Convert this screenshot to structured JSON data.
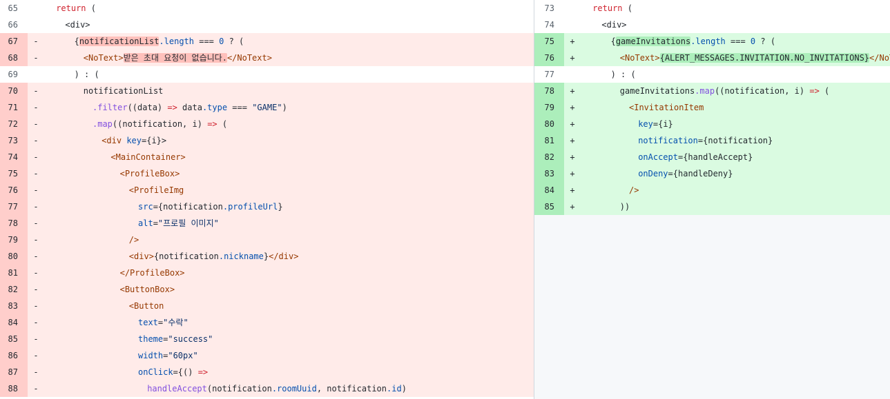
{
  "left_lines": [
    {
      "num": "65",
      "type": "ctx",
      "sign": "",
      "indent": 2,
      "tokens": [
        {
          "t": "return",
          "c": "kw"
        },
        {
          "t": " ("
        }
      ]
    },
    {
      "num": "66",
      "type": "ctx",
      "sign": "",
      "indent": 4,
      "tokens": [
        {
          "t": "<div>"
        }
      ]
    },
    {
      "num": "67",
      "type": "del",
      "sign": "-",
      "indent": 6,
      "tokens": [
        {
          "t": "{"
        },
        {
          "t": "notificationList",
          "c": "hl-del"
        },
        {
          "t": ".length",
          "c": "prop"
        },
        {
          "t": " === "
        },
        {
          "t": "0",
          "c": "num-lit"
        },
        {
          "t": " ? ("
        }
      ]
    },
    {
      "num": "68",
      "type": "del",
      "sign": "-",
      "indent": 8,
      "tokens": [
        {
          "t": "<NoText>",
          "c": "tag"
        },
        {
          "t": "받은 초대 요청이 없습니다.",
          "c": "hl-del"
        },
        {
          "t": "</NoText>",
          "c": "tag"
        }
      ]
    },
    {
      "num": "69",
      "type": "ctx",
      "sign": "",
      "indent": 6,
      "tokens": [
        {
          "t": ") : ("
        }
      ]
    },
    {
      "num": "70",
      "type": "del",
      "sign": "-",
      "indent": 8,
      "tokens": [
        {
          "t": "notificationList"
        }
      ]
    },
    {
      "num": "71",
      "type": "del",
      "sign": "-",
      "indent": 10,
      "tokens": [
        {
          "t": ".filter",
          "c": "fn"
        },
        {
          "t": "((data) "
        },
        {
          "t": "=>",
          "c": "kw"
        },
        {
          "t": " data"
        },
        {
          "t": ".type",
          "c": "prop"
        },
        {
          "t": " === "
        },
        {
          "t": "\"GAME\"",
          "c": "str"
        },
        {
          "t": ")"
        }
      ]
    },
    {
      "num": "72",
      "type": "del",
      "sign": "-",
      "indent": 10,
      "tokens": [
        {
          "t": ".map",
          "c": "fn"
        },
        {
          "t": "((notification, i) "
        },
        {
          "t": "=>",
          "c": "kw"
        },
        {
          "t": " ("
        }
      ]
    },
    {
      "num": "73",
      "type": "del",
      "sign": "-",
      "indent": 12,
      "tokens": [
        {
          "t": "<div",
          "c": "tag"
        },
        {
          "t": " key",
          "c": "attr"
        },
        {
          "t": "={i}>"
        }
      ]
    },
    {
      "num": "74",
      "type": "del",
      "sign": "-",
      "indent": 14,
      "tokens": [
        {
          "t": "<MainContainer>",
          "c": "tag"
        }
      ]
    },
    {
      "num": "75",
      "type": "del",
      "sign": "-",
      "indent": 16,
      "tokens": [
        {
          "t": "<ProfileBox>",
          "c": "tag"
        }
      ]
    },
    {
      "num": "76",
      "type": "del",
      "sign": "-",
      "indent": 18,
      "tokens": [
        {
          "t": "<ProfileImg",
          "c": "tag"
        }
      ]
    },
    {
      "num": "77",
      "type": "del",
      "sign": "-",
      "indent": 20,
      "tokens": [
        {
          "t": "src",
          "c": "attr"
        },
        {
          "t": "={notification"
        },
        {
          "t": ".profileUrl",
          "c": "prop"
        },
        {
          "t": "}"
        }
      ]
    },
    {
      "num": "78",
      "type": "del",
      "sign": "-",
      "indent": 20,
      "tokens": [
        {
          "t": "alt",
          "c": "attr"
        },
        {
          "t": "="
        },
        {
          "t": "\"프로필 이미지\"",
          "c": "str"
        }
      ]
    },
    {
      "num": "79",
      "type": "del",
      "sign": "-",
      "indent": 18,
      "tokens": [
        {
          "t": "/>",
          "c": "tag"
        }
      ]
    },
    {
      "num": "80",
      "type": "del",
      "sign": "-",
      "indent": 18,
      "tokens": [
        {
          "t": "<div>",
          "c": "tag"
        },
        {
          "t": "{notification"
        },
        {
          "t": ".nickname",
          "c": "prop"
        },
        {
          "t": "}"
        },
        {
          "t": "</div>",
          "c": "tag"
        }
      ]
    },
    {
      "num": "81",
      "type": "del",
      "sign": "-",
      "indent": 16,
      "tokens": [
        {
          "t": "</ProfileBox>",
          "c": "tag"
        }
      ]
    },
    {
      "num": "82",
      "type": "del",
      "sign": "-",
      "indent": 16,
      "tokens": [
        {
          "t": "<ButtonBox>",
          "c": "tag"
        }
      ]
    },
    {
      "num": "83",
      "type": "del",
      "sign": "-",
      "indent": 18,
      "tokens": [
        {
          "t": "<Button",
          "c": "tag"
        }
      ]
    },
    {
      "num": "84",
      "type": "del",
      "sign": "-",
      "indent": 20,
      "tokens": [
        {
          "t": "text",
          "c": "attr"
        },
        {
          "t": "="
        },
        {
          "t": "\"수락\"",
          "c": "str"
        }
      ]
    },
    {
      "num": "85",
      "type": "del",
      "sign": "-",
      "indent": 20,
      "tokens": [
        {
          "t": "theme",
          "c": "attr"
        },
        {
          "t": "="
        },
        {
          "t": "\"success\"",
          "c": "str"
        }
      ]
    },
    {
      "num": "86",
      "type": "del",
      "sign": "-",
      "indent": 20,
      "tokens": [
        {
          "t": "width",
          "c": "attr"
        },
        {
          "t": "="
        },
        {
          "t": "\"60px\"",
          "c": "str"
        }
      ]
    },
    {
      "num": "87",
      "type": "del",
      "sign": "-",
      "indent": 20,
      "tokens": [
        {
          "t": "onClick",
          "c": "attr"
        },
        {
          "t": "={() "
        },
        {
          "t": "=>",
          "c": "kw"
        }
      ]
    },
    {
      "num": "88",
      "type": "del",
      "sign": "-",
      "indent": 22,
      "tokens": [
        {
          "t": "handleAccept",
          "c": "fn"
        },
        {
          "t": "(notification"
        },
        {
          "t": ".roomUuid",
          "c": "prop"
        },
        {
          "t": ", notification"
        },
        {
          "t": ".id",
          "c": "prop"
        },
        {
          "t": ")"
        }
      ]
    }
  ],
  "right_lines": [
    {
      "num": "73",
      "type": "ctx",
      "sign": "",
      "indent": 2,
      "tokens": [
        {
          "t": "return",
          "c": "kw"
        },
        {
          "t": " ("
        }
      ]
    },
    {
      "num": "74",
      "type": "ctx",
      "sign": "",
      "indent": 4,
      "tokens": [
        {
          "t": "<div>"
        }
      ]
    },
    {
      "num": "75",
      "type": "add",
      "sign": "+",
      "indent": 6,
      "tokens": [
        {
          "t": "{"
        },
        {
          "t": "gameInvitations",
          "c": "hl-add"
        },
        {
          "t": ".length",
          "c": "prop"
        },
        {
          "t": " === "
        },
        {
          "t": "0",
          "c": "num-lit"
        },
        {
          "t": " ? ("
        }
      ]
    },
    {
      "num": "76",
      "type": "add",
      "sign": "+",
      "indent": 8,
      "tokens": [
        {
          "t": "<NoText>",
          "c": "tag"
        },
        {
          "t": "{ALERT_MESSAGES.INVITATION.NO_INVITATIONS}",
          "c": "hl-add"
        },
        {
          "t": "</NoText>",
          "c": "tag"
        }
      ]
    },
    {
      "num": "77",
      "type": "ctx",
      "sign": "",
      "indent": 6,
      "tokens": [
        {
          "t": ") : ("
        }
      ]
    },
    {
      "num": "78",
      "type": "add",
      "sign": "+",
      "indent": 8,
      "tokens": [
        {
          "t": "gameInvitations"
        },
        {
          "t": ".map",
          "c": "fn"
        },
        {
          "t": "((notification, i) "
        },
        {
          "t": "=>",
          "c": "kw"
        },
        {
          "t": " ("
        }
      ]
    },
    {
      "num": "79",
      "type": "add",
      "sign": "+",
      "indent": 10,
      "tokens": [
        {
          "t": "<InvitationItem",
          "c": "tag"
        }
      ]
    },
    {
      "num": "80",
      "type": "add",
      "sign": "+",
      "indent": 12,
      "tokens": [
        {
          "t": "key",
          "c": "attr"
        },
        {
          "t": "={i}"
        }
      ]
    },
    {
      "num": "81",
      "type": "add",
      "sign": "+",
      "indent": 12,
      "tokens": [
        {
          "t": "notification",
          "c": "attr"
        },
        {
          "t": "={notification}"
        }
      ]
    },
    {
      "num": "82",
      "type": "add",
      "sign": "+",
      "indent": 12,
      "tokens": [
        {
          "t": "onAccept",
          "c": "attr"
        },
        {
          "t": "={handleAccept}"
        }
      ]
    },
    {
      "num": "83",
      "type": "add",
      "sign": "+",
      "indent": 12,
      "tokens": [
        {
          "t": "onDeny",
          "c": "attr"
        },
        {
          "t": "={handleDeny}"
        }
      ]
    },
    {
      "num": "84",
      "type": "add",
      "sign": "+",
      "indent": 10,
      "tokens": [
        {
          "t": "/>",
          "c": "tag"
        }
      ]
    },
    {
      "num": "85",
      "type": "add",
      "sign": "+",
      "indent": 8,
      "tokens": [
        {
          "t": "))"
        }
      ]
    }
  ]
}
